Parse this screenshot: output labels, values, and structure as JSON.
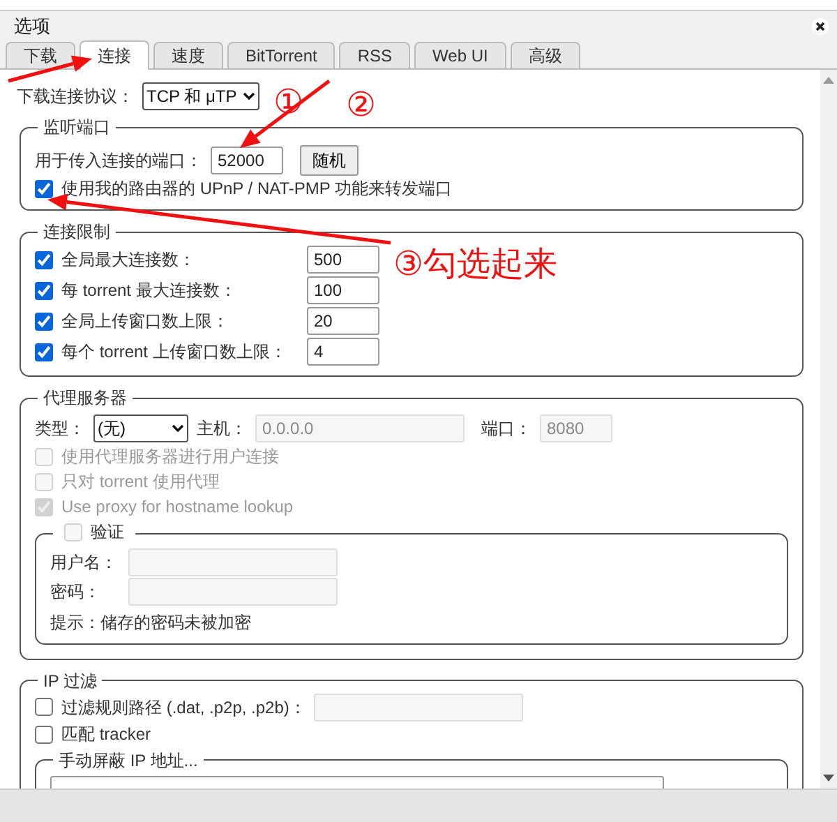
{
  "window": {
    "title": "选项"
  },
  "tabs": [
    {
      "label": "下载",
      "selected": false
    },
    {
      "label": "连接",
      "selected": true
    },
    {
      "label": "速度",
      "selected": false
    },
    {
      "label": "BitTorrent",
      "selected": false
    },
    {
      "label": "RSS",
      "selected": false
    },
    {
      "label": "Web UI",
      "selected": false
    },
    {
      "label": "高级",
      "selected": false
    }
  ],
  "protocol": {
    "label": "下载连接协议：",
    "value": "TCP 和 μTP"
  },
  "listening_port": {
    "legend": "监听端口",
    "port_label": "用于传入连接的端口：",
    "port": "52000",
    "random_button": "随机",
    "upnp": {
      "label": "使用我的路由器的 UPnP / NAT-PMP 功能来转发端口",
      "checked": true
    }
  },
  "connection_limits": {
    "legend": "连接限制",
    "rows": [
      {
        "label": "全局最大连接数：",
        "checked": true,
        "value": "500"
      },
      {
        "label": "每 torrent 最大连接数：",
        "checked": true,
        "value": "100"
      },
      {
        "label": "全局上传窗口数上限：",
        "checked": true,
        "value": "20"
      },
      {
        "label": "每个 torrent 上传窗口数上限：",
        "checked": true,
        "value": "4"
      }
    ]
  },
  "proxy": {
    "legend": "代理服务器",
    "type_label": "类型：",
    "type": "(无)",
    "host_label": "主机：",
    "host": "0.0.0.0",
    "port_label": "端口：",
    "port": "8080",
    "fields_disabled": true,
    "options": [
      {
        "label": "使用代理服务器进行用户连接",
        "checked": false,
        "disabled": true
      },
      {
        "label": "只对 torrent 使用代理",
        "checked": false,
        "disabled": true
      },
      {
        "label": "Use proxy for hostname lookup",
        "checked": true,
        "disabled": true
      }
    ],
    "auth": {
      "legend": "验证",
      "checked": false,
      "disabled": true,
      "username_label": "用户名：",
      "password_label": "密码：",
      "hint": "提示：储存的密码未被加密"
    }
  },
  "ip_filter": {
    "legend": "IP 过滤",
    "options": [
      {
        "kind": "path",
        "label": "过滤规则路径 (.dat, .p2p, .p2b)：",
        "checked": false
      },
      {
        "kind": "plain",
        "label": "匹配 tracker",
        "checked": false
      }
    ],
    "manual": {
      "legend": "手动屏蔽 IP 地址..."
    }
  },
  "annotations": [
    {
      "text": "①"
    },
    {
      "text": "②"
    },
    {
      "text": "③勾选起来"
    }
  ]
}
